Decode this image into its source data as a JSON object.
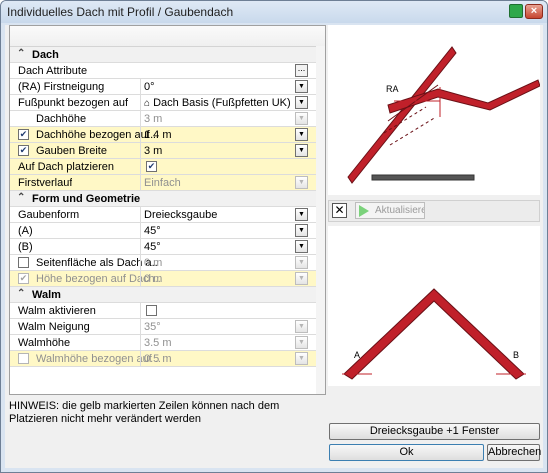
{
  "window": {
    "title": "Individuelles Dach mit Profil / Gaubendach"
  },
  "sections": {
    "dach": {
      "label": "Dach",
      "rows": {
        "attribute": {
          "label": "Dach Attribute",
          "button": "..."
        },
        "firstneigung": {
          "label": "(RA) Firstneigung",
          "value": "0°"
        },
        "fusspunkt": {
          "label": "Fußpunkt bezogen auf",
          "value": "Dach Basis (Fußpfetten UK)"
        },
        "dachhoehe": {
          "label": "Dachhöhe",
          "value": "3 m"
        },
        "dachhoehe_bezogen": {
          "label": "Dachhöhe bezogen auf ..",
          "value": "1.4 m",
          "checked": true
        },
        "gauben_breite": {
          "label": "Gauben Breite",
          "value": "3 m",
          "checked": true
        },
        "auf_dach": {
          "label": "Auf Dach platzieren",
          "checked": true
        },
        "firstverlauf": {
          "label": "Firstverlauf",
          "value": "Einfach"
        }
      }
    },
    "form": {
      "label": "Form und Geometrie",
      "rows": {
        "gaubenform": {
          "label": "Gaubenform",
          "value": "Dreiecksgaube"
        },
        "a": {
          "label": "(A)",
          "value": "45°"
        },
        "b": {
          "label": "(B)",
          "value": "45°"
        },
        "seitenflaeche": {
          "label": "Seitenfläche als Dach a..",
          "value": "0 m",
          "checked": false
        },
        "hoehe_bezogen": {
          "label": "Höhe bezogen auf Dach..",
          "value": "0 m",
          "checked": true
        }
      }
    },
    "walm": {
      "label": "Walm",
      "rows": {
        "aktivieren": {
          "label": "Walm aktivieren",
          "checked": false
        },
        "neigung": {
          "label": "Walm Neigung",
          "value": "35°"
        },
        "hoehe": {
          "label": "Walmhöhe",
          "value": "3.5 m"
        },
        "hoehe_bezogen": {
          "label": "Walmhöhe bezogen auf ..",
          "value": "0.5 m",
          "checked": false
        }
      }
    }
  },
  "preview": {
    "top_angle_label": "RA",
    "bottom_left_label": "A",
    "bottom_right_label": "B",
    "roof_color": "#c0202a",
    "base_color": "#555555"
  },
  "toolbar": {
    "close_symbol": "✕",
    "refresh_label": "Aktualisieren"
  },
  "footer": {
    "hint": "HINWEIS: die gelb markierten Zeilen können nach dem Platzieren nicht mehr verändert werden",
    "preset_button": "Dreiecksgaube +1 Fenster",
    "ok_button": "Ok",
    "cancel_button": "Abbrechen"
  }
}
